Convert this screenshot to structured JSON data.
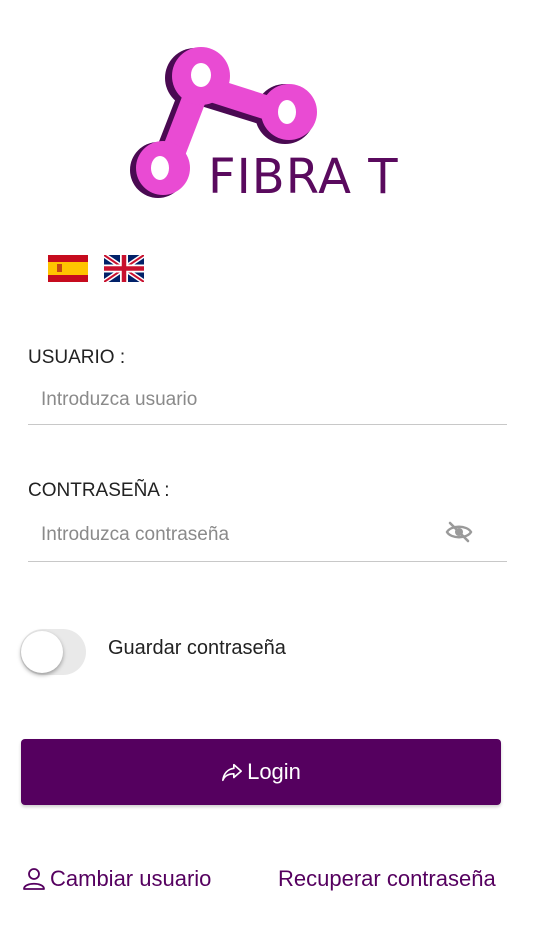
{
  "brand": {
    "name": "FIBRA T",
    "primary_color": "#55005f",
    "accent_color": "#e94bd3"
  },
  "languages": [
    {
      "code": "es",
      "icon": "spain-flag-icon"
    },
    {
      "code": "en",
      "icon": "uk-flag-icon"
    }
  ],
  "form": {
    "user_label": "USUARIO :",
    "user_placeholder": "Introduzca usuario",
    "password_label": "CONTRASEÑA :",
    "password_placeholder": "Introduzca contraseña",
    "remember_label": "Guardar contraseña",
    "remember_checked": false
  },
  "actions": {
    "login_label": "Login",
    "change_user_label": "Cambiar usuario",
    "recover_password_label": "Recuperar contraseña"
  }
}
